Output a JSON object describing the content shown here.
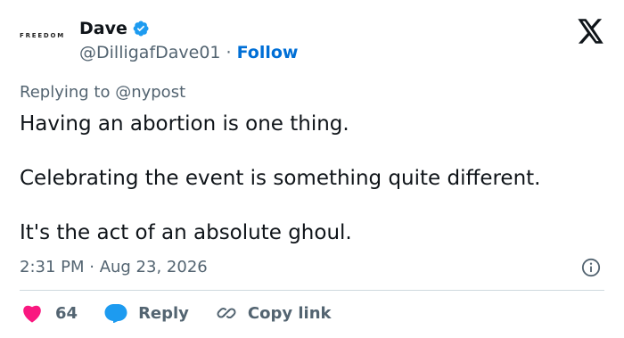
{
  "author": {
    "avatar_text": "FREEDOM",
    "display_name": "Dave",
    "handle": "@DilligafDave01",
    "separator": "·",
    "follow_label": "Follow"
  },
  "tweet": {
    "replying_to": "Replying to @nypost",
    "lines": [
      "Having an abortion is one thing.",
      "Celebrating the event is something quite different.",
      "It's the act of an absolute ghoul."
    ],
    "timestamp": "2:31 PM · Aug 23, 2026"
  },
  "actions": {
    "like_count": "64",
    "reply_label": "Reply",
    "copy_link_label": "Copy link"
  },
  "colors": {
    "accent": "#1d9bf0",
    "link": "#006fd6",
    "like": "#f91880",
    "muted": "#536471"
  }
}
